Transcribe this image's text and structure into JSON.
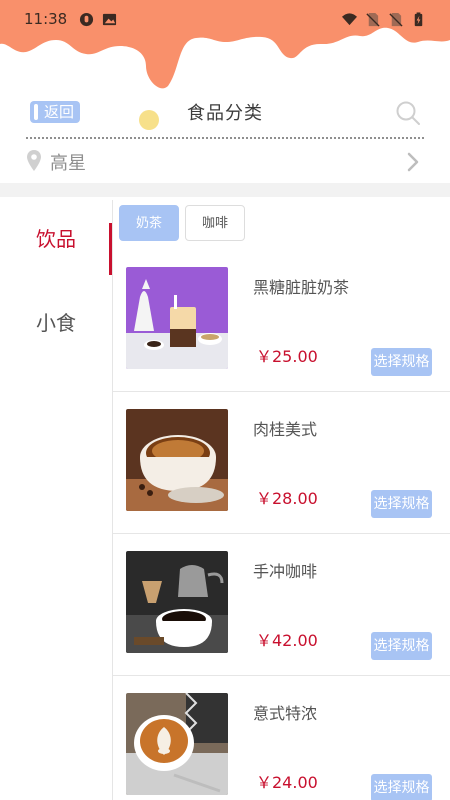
{
  "status_bar": {
    "time": "11:38",
    "left_icons": [
      "notification-icon",
      "image-icon"
    ],
    "right_icons": [
      "wifi-icon",
      "no-sim-icon",
      "no-sim-icon",
      "battery-charging-icon"
    ]
  },
  "header": {
    "back_label": "返回",
    "title": "食品分类",
    "search_icon": "search-icon"
  },
  "location": {
    "name": "高星",
    "icon": "location-pin-icon",
    "arrow": "chevron-right-icon"
  },
  "categories": [
    {
      "label": "饮品",
      "active": true
    },
    {
      "label": "小食",
      "active": false
    }
  ],
  "subtabs": [
    {
      "label": "奶茶",
      "active": true
    },
    {
      "label": "咖啡",
      "active": false
    }
  ],
  "products": [
    {
      "name": "黑糖脏脏奶茶",
      "price": "￥25.00",
      "button": "选择规格",
      "image": "bubble-tea-image"
    },
    {
      "name": "肉桂美式",
      "price": "￥28.00",
      "button": "选择规格",
      "image": "americano-image"
    },
    {
      "name": "手冲咖啡",
      "price": "￥42.00",
      "button": "选择规格",
      "image": "pour-over-coffee-image"
    },
    {
      "name": "意式特浓",
      "price": "￥24.00",
      "button": "选择规格",
      "image": "latte-art-image"
    }
  ],
  "colors": {
    "header": "#f9906b",
    "accent_blue": "#a8c4f4",
    "accent_red": "#c8102e"
  }
}
